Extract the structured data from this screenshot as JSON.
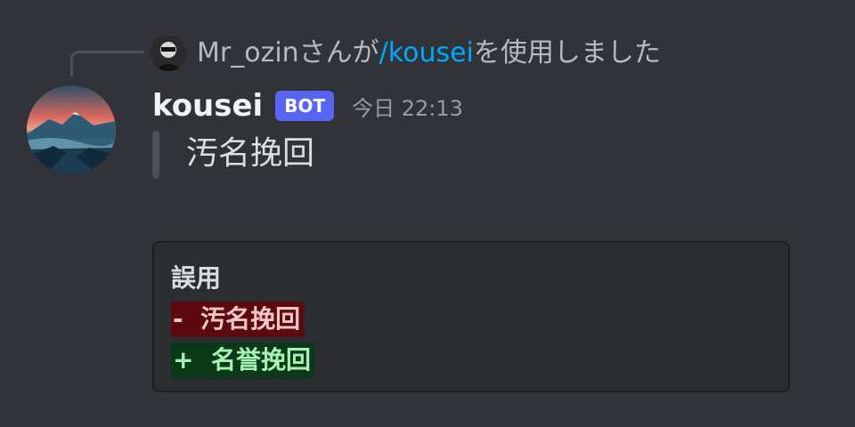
{
  "reply": {
    "user": "Mr_ozin",
    "text_before": "さんが",
    "command": "/kousei",
    "text_after": "を使用しました"
  },
  "message": {
    "username": "kousei",
    "badge": "BOT",
    "timestamp": "今日 22:13",
    "quote": "汚名挽回"
  },
  "embed": {
    "title": "誤用",
    "removed_prefix": "-",
    "removed": "汚名挽回",
    "added_prefix": "+",
    "added": "名誉挽回"
  },
  "colors": {
    "background": "#313338",
    "command_link": "#00a8fc",
    "bot_badge": "#5865f2",
    "diff_removed_bg": "#5c0a0f",
    "diff_added_bg": "#0b3a18"
  }
}
